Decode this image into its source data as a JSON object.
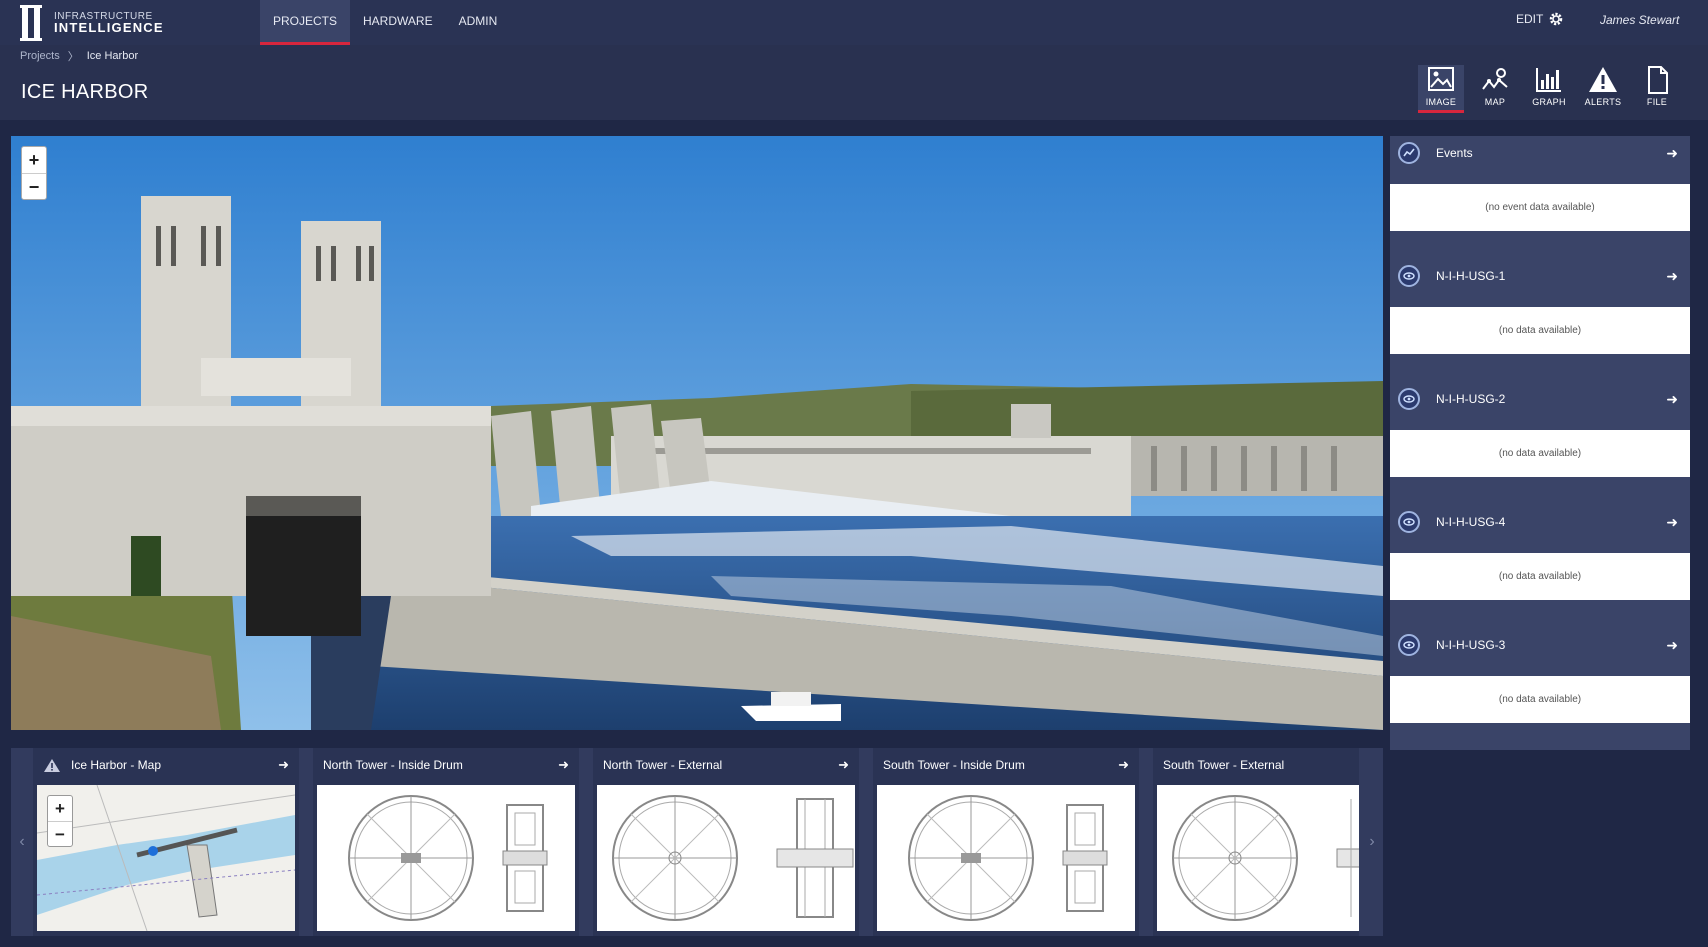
{
  "brand": {
    "line1": "INFRASTRUCTURE",
    "line2": "INTELLIGENCE"
  },
  "nav": {
    "items": [
      {
        "label": "PROJECTS"
      },
      {
        "label": "HARDWARE"
      },
      {
        "label": "ADMIN"
      }
    ],
    "active": "PROJECTS"
  },
  "header": {
    "edit_label": "EDIT",
    "user_name": "James Stewart"
  },
  "breadcrumb": {
    "items": [
      "Projects",
      "Ice Harbor"
    ]
  },
  "page": {
    "title": "ICE HARBOR"
  },
  "view_tabs": {
    "items": [
      {
        "label": "IMAGE",
        "icon": "image-icon"
      },
      {
        "label": "MAP",
        "icon": "map-icon"
      },
      {
        "label": "GRAPH",
        "icon": "graph-icon"
      },
      {
        "label": "ALERTS",
        "icon": "alert-icon"
      },
      {
        "label": "FILE",
        "icon": "file-icon"
      }
    ],
    "active": "IMAGE"
  },
  "main_image": {
    "zoom_in": "+",
    "zoom_out": "−"
  },
  "right_panel": {
    "items": [
      {
        "title": "Events",
        "message": "(no event data available)",
        "icon": "events-icon"
      },
      {
        "title": "N-I-H-USG-1",
        "message": "(no data available)",
        "icon": "sensor-icon"
      },
      {
        "title": "N-I-H-USG-2",
        "message": "(no data available)",
        "icon": "sensor-icon"
      },
      {
        "title": "N-I-H-USG-4",
        "message": "(no data available)",
        "icon": "sensor-icon"
      },
      {
        "title": "N-I-H-USG-3",
        "message": "(no data available)",
        "icon": "sensor-icon"
      }
    ]
  },
  "bottom_strip": {
    "thumbnails": [
      {
        "title": "Ice Harbor - Map",
        "kind": "map"
      },
      {
        "title": "North Tower - Inside Drum",
        "kind": "drawing"
      },
      {
        "title": "North Tower - External",
        "kind": "drawing"
      },
      {
        "title": "South Tower - Inside Drum",
        "kind": "drawing"
      },
      {
        "title": "South Tower - External",
        "kind": "drawing"
      }
    ],
    "map_zoom_in": "+",
    "map_zoom_out": "−"
  },
  "colors": {
    "accent": "#d7263d",
    "background": "#1f2745",
    "header": "#2a3354",
    "panel": "#3a4468"
  }
}
